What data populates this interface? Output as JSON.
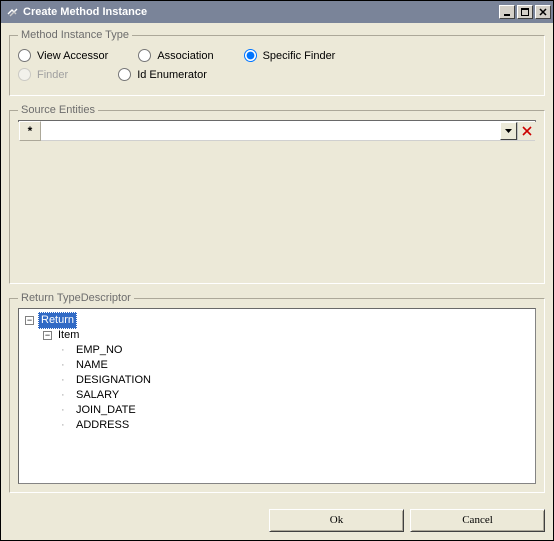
{
  "window": {
    "title": "Create Method Instance"
  },
  "winbuttons": {
    "min": "minimize",
    "max": "maximize",
    "close": "close"
  },
  "group_method_type": {
    "legend": "Method Instance Type",
    "options": {
      "view_accessor": "View Accessor",
      "association": "Association",
      "specific_finder": "Specific Finder",
      "finder": "Finder",
      "id_enumerator": "Id Enumerator"
    },
    "selected": "specific_finder",
    "finder_disabled": true
  },
  "group_source": {
    "legend": "Source Entities",
    "new_row_marker": "*"
  },
  "group_return": {
    "legend": "Return TypeDescriptor",
    "root": "Return",
    "item": "Item",
    "fields": [
      "EMP_NO",
      "NAME",
      "DESIGNATION",
      "SALARY",
      "JOIN_DATE",
      "ADDRESS"
    ]
  },
  "buttons": {
    "ok": "Ok",
    "cancel": "Cancel"
  }
}
